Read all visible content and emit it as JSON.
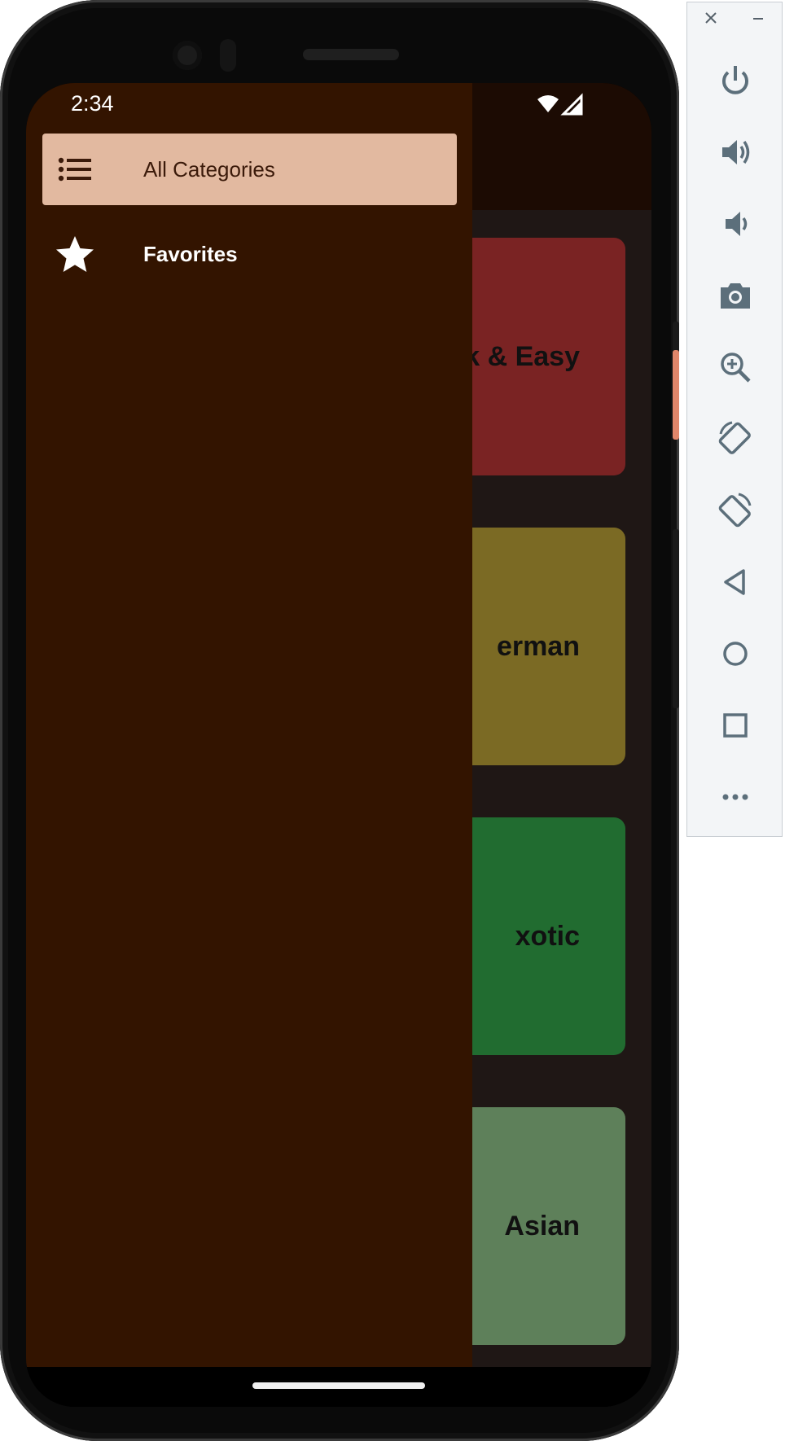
{
  "status_bar": {
    "time": "2:34"
  },
  "drawer": {
    "items": [
      {
        "label": "All Categories",
        "icon": "list-icon",
        "active": true
      },
      {
        "label": "Favorites",
        "icon": "star-icon",
        "active": false
      }
    ]
  },
  "categories": [
    {
      "label": "k & Easy",
      "color": "#7a2323"
    },
    {
      "label": "erman",
      "color": "#7b6a24"
    },
    {
      "label": "xotic",
      "color": "#216c30"
    },
    {
      "label": "Asian",
      "color": "#5e805a"
    }
  ],
  "emulator_toolbar": {
    "buttons": [
      "close-icon",
      "minimize-icon",
      "power-icon",
      "volume-up-icon",
      "volume-down-icon",
      "camera-icon",
      "zoom-icon",
      "rotate-left-icon",
      "rotate-right-icon",
      "back-icon",
      "home-icon",
      "overview-icon",
      "more-icon"
    ]
  }
}
